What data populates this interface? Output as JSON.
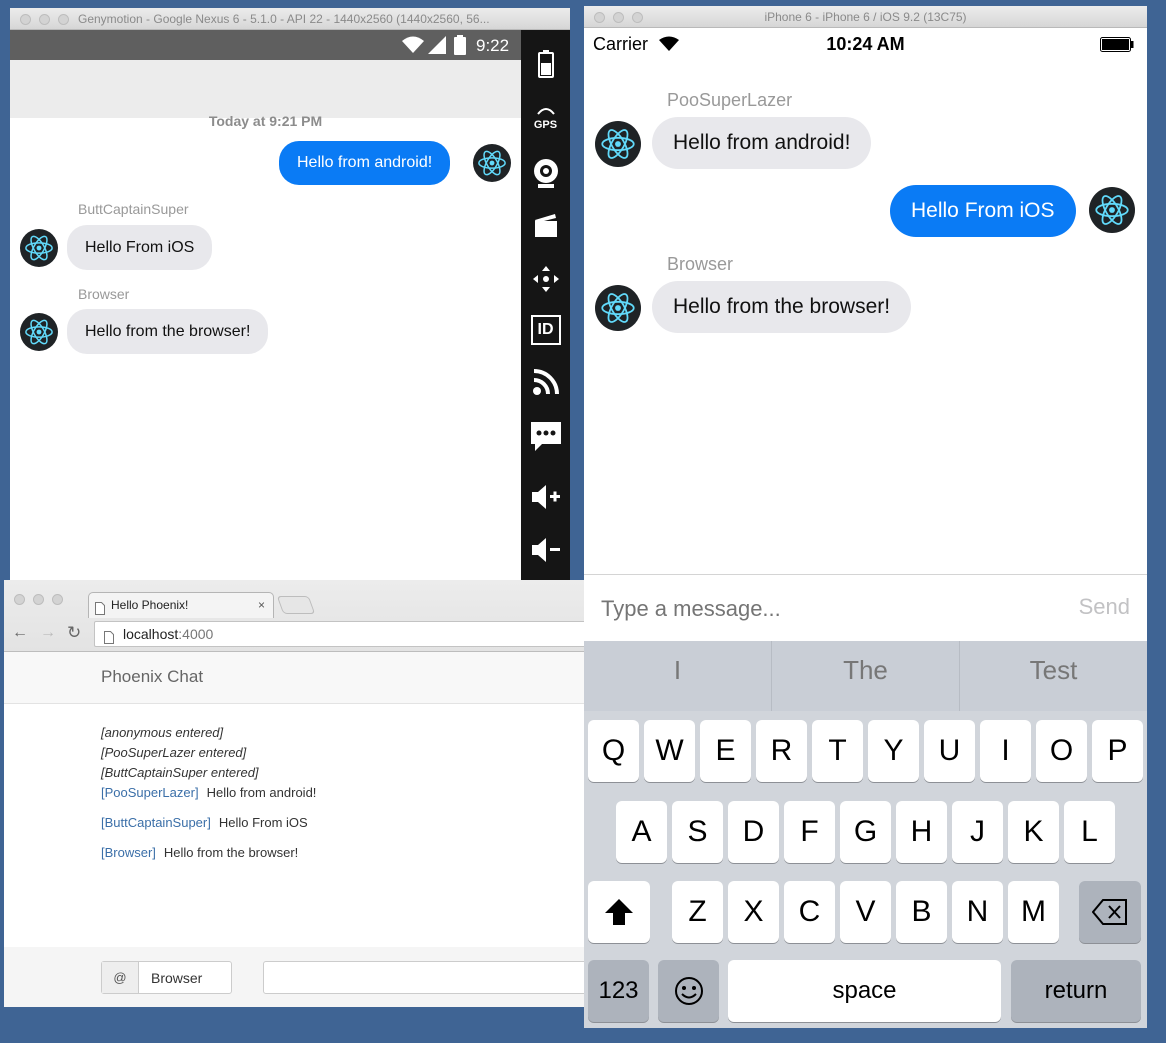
{
  "android": {
    "window_title": "Genymotion - Google Nexus 6 - 5.1.0 - API 22 - 1440x2560 (1440x2560, 56...",
    "time": "9:22",
    "timestamp": "Today at 9:21 PM",
    "messages": [
      {
        "user": "",
        "text": "Hello from android!",
        "own": true
      },
      {
        "user": "ButtCaptainSuper",
        "text": "Hello From iOS",
        "own": false
      },
      {
        "user": "Browser",
        "text": "Hello from the browser!",
        "own": false
      }
    ],
    "sidebar": {
      "gps": "GPS",
      "id": "ID"
    }
  },
  "ios": {
    "window_title": "iPhone 6 - iPhone 6 / iOS 9.2 (13C75)",
    "carrier": "Carrier",
    "time": "10:24 AM",
    "messages": [
      {
        "user": "PooSuperLazer",
        "text": "Hello from android!",
        "own": false
      },
      {
        "user": "",
        "text": "Hello From iOS",
        "own": true
      },
      {
        "user": "Browser",
        "text": "Hello from the browser!",
        "own": false
      }
    ],
    "input_placeholder": "Type a message...",
    "send": "Send",
    "suggestions": [
      "I",
      "The",
      "Test"
    ],
    "keys_row1": [
      "Q",
      "W",
      "E",
      "R",
      "T",
      "Y",
      "U",
      "I",
      "O",
      "P"
    ],
    "keys_row2": [
      "A",
      "S",
      "D",
      "F",
      "G",
      "H",
      "J",
      "K",
      "L"
    ],
    "keys_row3": [
      "Z",
      "X",
      "C",
      "V",
      "B",
      "N",
      "M"
    ],
    "key_123": "123",
    "key_space": "space",
    "key_return": "return"
  },
  "browser": {
    "tab_title": "Hello Phoenix!",
    "url_host": "localhost",
    "url_port": ":4000",
    "app_title": "Phoenix Chat",
    "events": [
      "[anonymous entered]",
      "[PooSuperLazer entered]",
      "[ButtCaptainSuper entered]"
    ],
    "messages": [
      {
        "user": "[PooSuperLazer]",
        "text": "Hello from android!"
      },
      {
        "user": "[ButtCaptainSuper]",
        "text": "Hello From iOS"
      },
      {
        "user": "[Browser]",
        "text": "Hello from the browser!"
      }
    ],
    "at_label": "@",
    "name_value": "Browser"
  }
}
